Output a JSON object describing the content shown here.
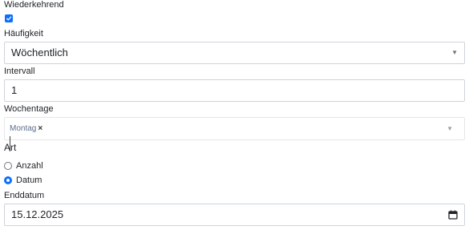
{
  "recurring": {
    "label": "Wiederkehrend",
    "checked": true
  },
  "frequency": {
    "label": "Häufigkeit",
    "value": "Wöchentlich"
  },
  "interval": {
    "label": "Intervall",
    "value": "1"
  },
  "weekdays": {
    "label": "Wochentage",
    "tags": [
      {
        "text": "Montag",
        "remove": "×"
      }
    ]
  },
  "type": {
    "label": "Art",
    "options": [
      {
        "label": "Anzahl",
        "selected": false
      },
      {
        "label": "Datum",
        "selected": true
      }
    ]
  },
  "end_date": {
    "label": "Enddatum",
    "value": "15.12.2025"
  },
  "colors": {
    "accent": "#0d6efd",
    "border": "#ced4da",
    "tag_text": "#5a6b8c"
  }
}
